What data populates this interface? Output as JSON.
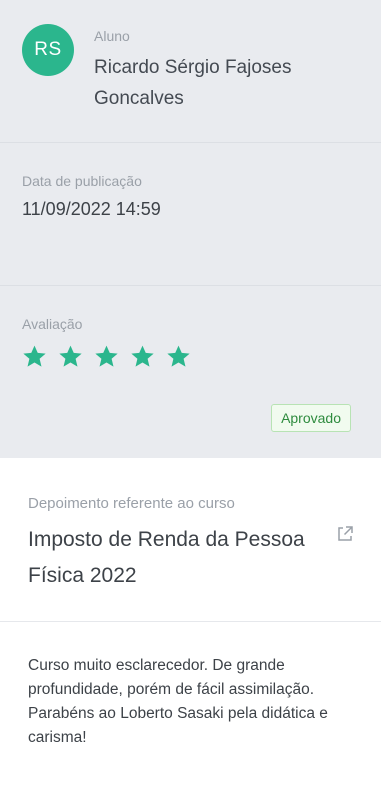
{
  "student": {
    "initials": "RS",
    "label": "Aluno",
    "name": "Ricardo Sérgio Fajoses Goncalves",
    "avatar_color": "#2bb68d"
  },
  "publication": {
    "label": "Data de publicação",
    "value": "11/09/2022 14:59"
  },
  "rating": {
    "label": "Avaliação",
    "stars": 5,
    "max_stars": 5,
    "star_color": "#2bb68d",
    "status": "Aprovado"
  },
  "course": {
    "label": "Depoimento referente ao curso",
    "title": "Imposto de Renda da Pessoa Física 2022",
    "link_icon": "external-link-icon"
  },
  "testimonial": {
    "text": "Curso muito esclarecedor. De grande profundidade, porém de fácil assimilação. Parabéns ao Loberto Sasaki pela didática e carisma!"
  }
}
